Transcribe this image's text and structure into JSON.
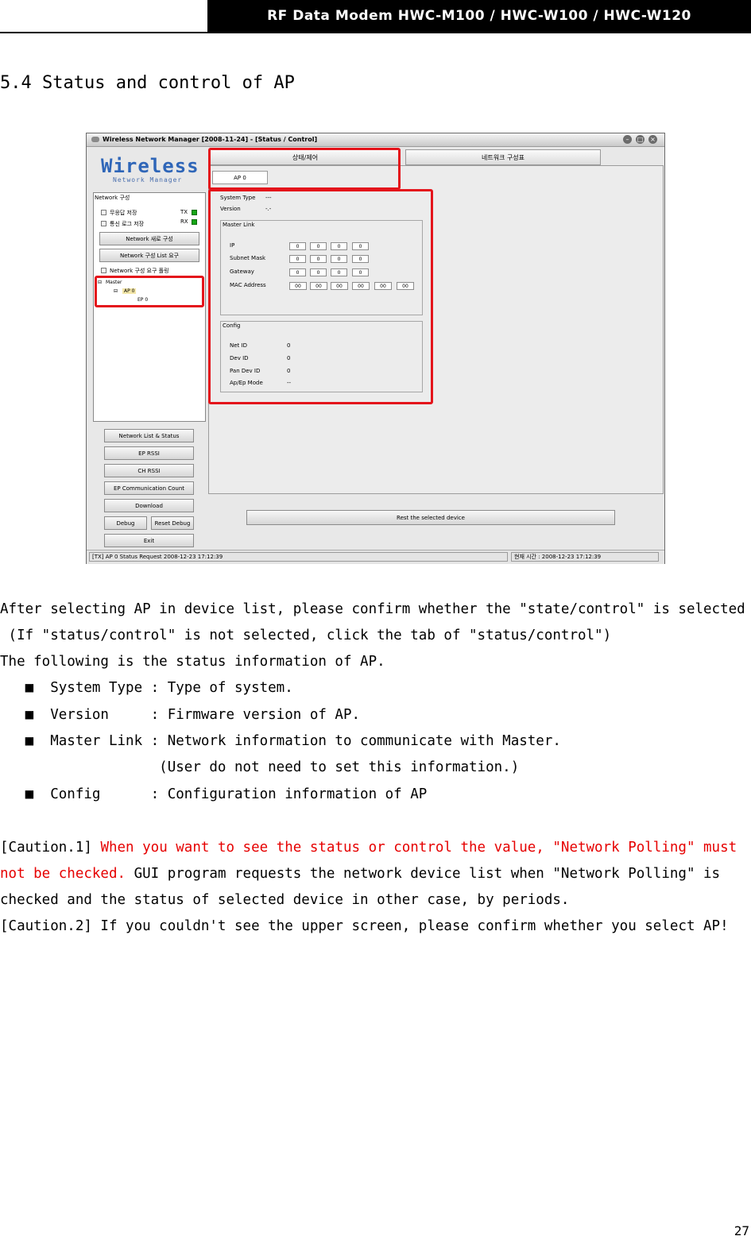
{
  "header": {
    "title": "RF Data Modem HWC-M100 / HWC-W100 / HWC-W120"
  },
  "section": {
    "title": "5.4 Status and control of AP"
  },
  "screenshot": {
    "window_title": "Wireless Network Manager [2008-11-24] - [Status / Control]",
    "logo_text": "Wireless",
    "logo_sub": "Network Manager",
    "network_group_label": "Network 구성",
    "checkbox_no_response_save": "무응답 저장",
    "checkbox_comm_log_save": "통신 로그 저장",
    "tx_label": "TX",
    "rx_label": "RX",
    "btn_new_network": "Network 새로 구성",
    "btn_request_list": "Network 구성 List 요구",
    "checkbox_polling": "Network 구성 요구 폴링",
    "tree": {
      "master": "Master",
      "ap": "AP 0",
      "ep": "EP 0"
    },
    "buttons": {
      "network_list_status": "Network List & Status",
      "ep_rssi": "EP RSSI",
      "ch_rssi": "CH RSSI",
      "ep_comm_count": "EP Communication Count",
      "download": "Download",
      "debug": "Debug",
      "reset_debug": "Reset Debug",
      "exit": "Exit",
      "reset_selected": "Rest the selected device"
    },
    "tabs": {
      "status_control": "상태/제어",
      "network_config": "네트워크 구성표"
    },
    "subtab": "AP 0",
    "system_type_label": "System Type",
    "system_type_value": "---",
    "version_label": "Version",
    "version_value": "-.-",
    "master_link": {
      "title": "Master Link",
      "ip_label": "IP",
      "ip": [
        "0",
        "0",
        "0",
        "0"
      ],
      "subnet_label": "Subnet Mask",
      "subnet": [
        "0",
        "0",
        "0",
        "0"
      ],
      "gateway_label": "Gateway",
      "gateway": [
        "0",
        "0",
        "0",
        "0"
      ],
      "mac_label": "MAC Address",
      "mac": [
        "00",
        "00",
        "00",
        "00",
        "00",
        "00"
      ]
    },
    "config": {
      "title": "Config",
      "net_id_label": "Net ID",
      "net_id": "0",
      "dev_id_label": "Dev ID",
      "dev_id": "0",
      "pan_dev_id_label": "Pan Dev ID",
      "pan_dev_id": "0",
      "mode_label": "Ap/Ep Mode",
      "mode": "--"
    },
    "status_left": "[TX] AP 0  Status Request 2008-12-23 17:12:39",
    "status_right": "현재 시간 : 2008-12-23 17:12:39"
  },
  "body": {
    "line1": "After selecting AP in device list, please confirm whether the \"state/control\" is selected",
    "line2": " (If \"status/control\" is not selected, click the tab of \"status/control\")",
    "line3": "The following is the status information of AP.",
    "bullet1": "   ■  System Type : Type of system.",
    "bullet2": "   ■  Version     : Firmware version of AP.",
    "bullet3": "   ■  Master Link : Network information to communicate with Master.",
    "bullet3b": "                   (User do not need to set this information.)",
    "bullet4": "   ■  Config      : Configuration information of AP",
    "caution1_prefix": "[Caution.1] ",
    "caution1_red_a": "When you want to see the status or control the value, \"Network Polling\" must",
    "caution1_red_b": "not be checked.",
    "caution1_rest": " GUI program requests the network device list when \"Network Polling\" is",
    "caution1_line3": "checked and the status of selected device in other case, by periods.",
    "caution2": "[Caution.2] If you couldn't see the upper screen, please confirm whether you select AP!"
  },
  "page_number": "27",
  "colors": {
    "header_bg": "#000000",
    "highlight": "#e4141b",
    "caution": "#e60000"
  }
}
